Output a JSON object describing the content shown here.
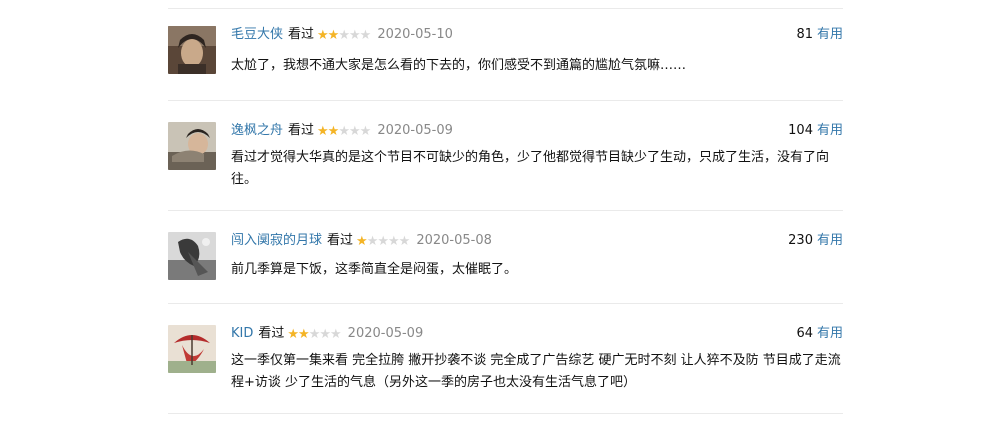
{
  "comments": [
    {
      "user": "毛豆大侠",
      "status": "看过",
      "rating": 2,
      "date": "2020-05-10",
      "votes": "81",
      "useful_label": "有用",
      "text": "太尬了，我想不通大家是怎么看的下去的，你们感受不到通篇的尴尬气氛嘛……"
    },
    {
      "user": "逸枫之舟",
      "status": "看过",
      "rating": 2,
      "date": "2020-05-09",
      "votes": "104",
      "useful_label": "有用",
      "text": "看过才觉得大华真的是这个节目不可缺少的角色，少了他都觉得节目缺少了生动，只成了生活，没有了向往。"
    },
    {
      "user": "闯入阒寂的月球",
      "status": "看过",
      "rating": 1,
      "date": "2020-05-08",
      "votes": "230",
      "useful_label": "有用",
      "text": "前几季算是下饭，这季简直全是闷蛋，太催眠了。"
    },
    {
      "user": "KID",
      "status": "看过",
      "rating": 2,
      "date": "2020-05-09",
      "votes": "64",
      "useful_label": "有用",
      "text": "这一季仅第一集来看 完全拉胯 撇开抄袭不谈 完全成了广告综艺 硬广无时不刻 让人猝不及防 节目成了走流程+访谈 少了生活的气息（另外这一季的房子也太没有生活气息了吧）"
    }
  ]
}
